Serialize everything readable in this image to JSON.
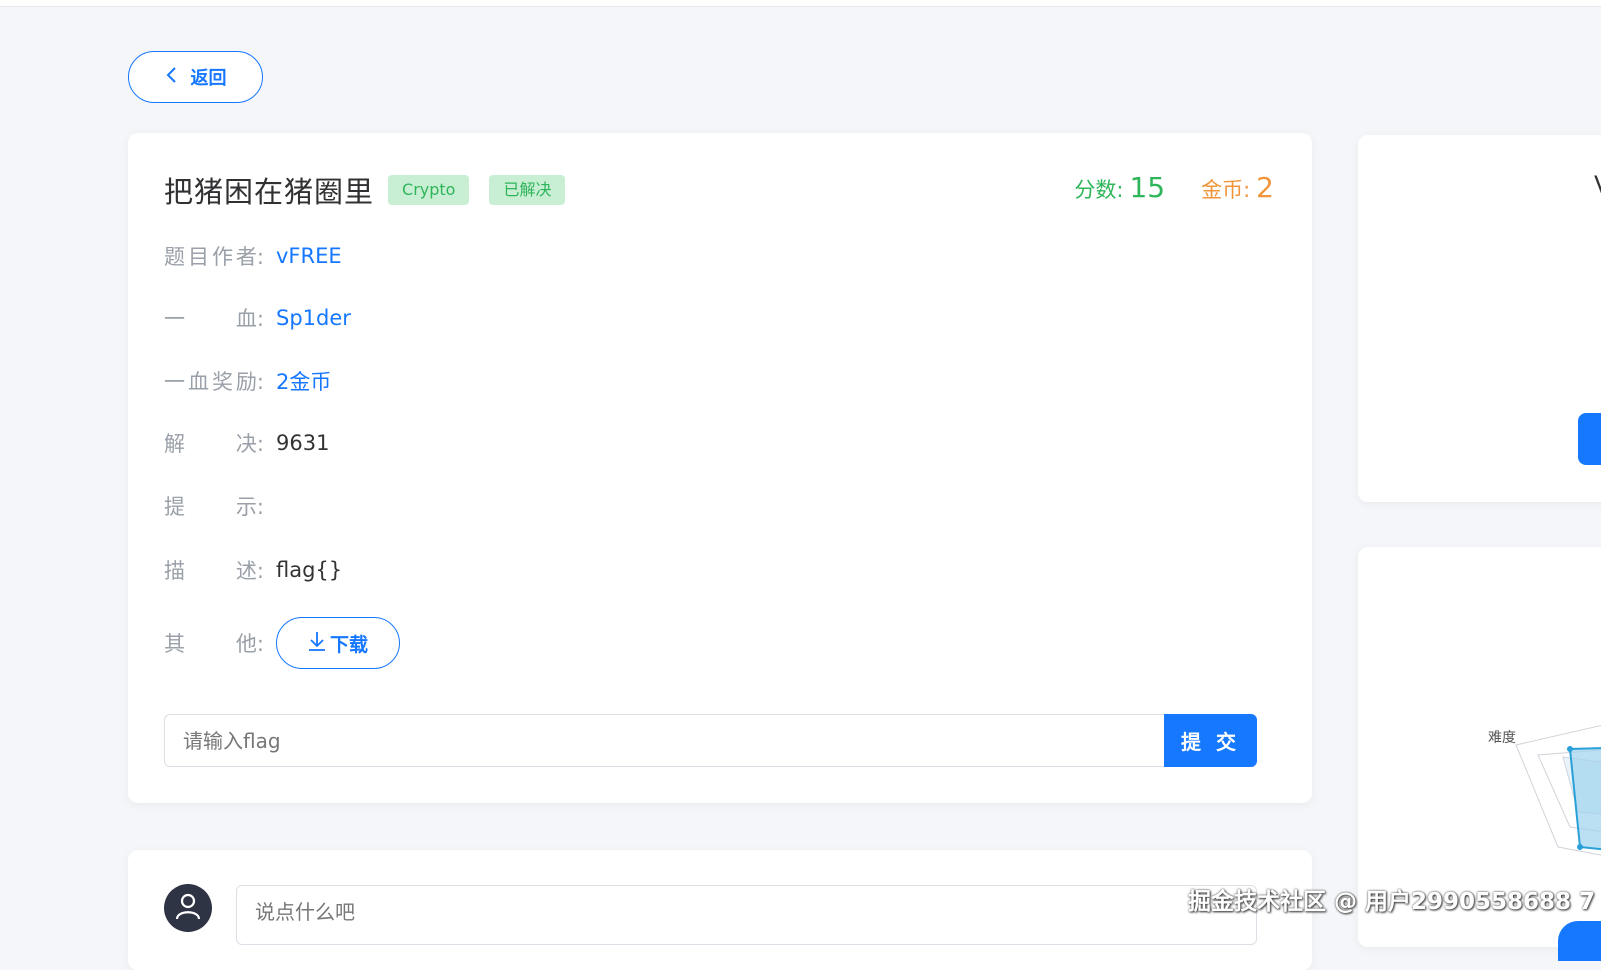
{
  "nav": {
    "back_label": "返回"
  },
  "challenge": {
    "title": "把猪困在猪圈里",
    "category_tag": "Crypto",
    "status_tag": "已解决",
    "score_label": "分数:",
    "score_value": "15",
    "coin_label": "金币:",
    "coin_value": "2",
    "info": {
      "author": {
        "label_chars": [
          "题",
          "目",
          "作",
          "者"
        ],
        "value": "vFREE"
      },
      "first_blood": {
        "label_chars": [
          "一",
          "血"
        ],
        "value": "Sp1der"
      },
      "first_blood_reward": {
        "label_chars": [
          "一",
          "血",
          "奖",
          "励"
        ],
        "value": "2金币"
      },
      "solves": {
        "label_chars": [
          "解",
          "决"
        ],
        "value": "9631"
      },
      "hint": {
        "label_chars": [
          "提",
          "示"
        ],
        "value": ""
      },
      "description": {
        "label_chars": [
          "描",
          "述"
        ],
        "value": "flag{}"
      },
      "other": {
        "label_chars": [
          "其",
          "他"
        ],
        "download_label": "下载"
      }
    },
    "label_colon": ":",
    "flag_placeholder": "请输入flag",
    "submit_label": "提 交"
  },
  "sidebar": {
    "card1_glyph": "V",
    "radar_label": "难度"
  },
  "comment": {
    "placeholder": "说点什么吧"
  },
  "watermark": "掘金技术社区 @ 用户2990558688 7",
  "colors": {
    "accent": "#1677ff",
    "success": "#2fb55a",
    "coin": "#f0953a",
    "tag_bg": "#c8eed3"
  },
  "icons": {
    "back": "chevron-left-icon",
    "download": "download-arrow-icon",
    "avatar": "user-icon"
  }
}
